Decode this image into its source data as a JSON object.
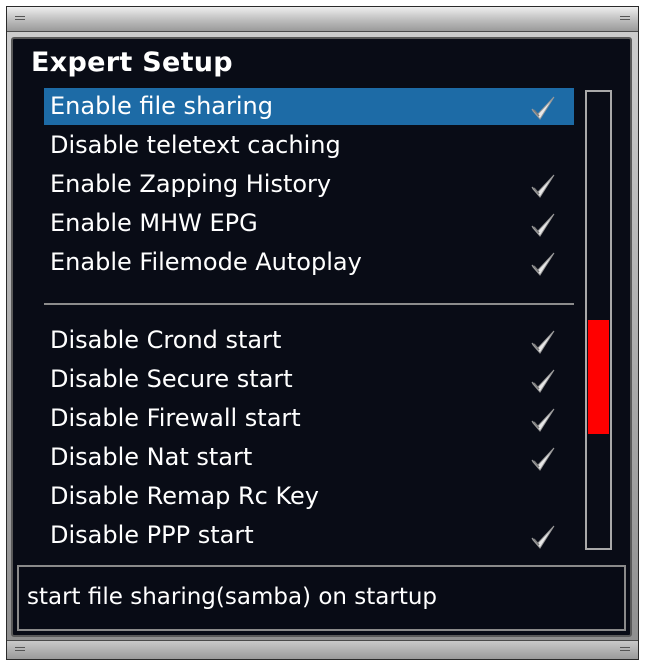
{
  "window": {
    "title": "Expert Setup"
  },
  "menu": {
    "items": [
      {
        "label": "Enable file sharing",
        "checked": true,
        "selected": true
      },
      {
        "label": "Disable teletext caching",
        "checked": false,
        "selected": false
      },
      {
        "label": "Enable Zapping History",
        "checked": true,
        "selected": false
      },
      {
        "label": "Enable MHW EPG",
        "checked": true,
        "selected": false
      },
      {
        "label": "Enable Filemode Autoplay",
        "checked": true,
        "selected": false
      },
      {
        "label": "Disable Crond start",
        "checked": true,
        "selected": false
      },
      {
        "label": "Disable Secure start",
        "checked": true,
        "selected": false
      },
      {
        "label": "Disable Firewall start",
        "checked": true,
        "selected": false
      },
      {
        "label": "Disable Nat start",
        "checked": true,
        "selected": false
      },
      {
        "label": "Disable Remap Rc Key",
        "checked": false,
        "selected": false
      },
      {
        "label": "Disable PPP start",
        "checked": true,
        "selected": false
      }
    ]
  },
  "scrollbar": {
    "thumb_start_fraction": 0.5,
    "thumb_length_fraction": 0.25,
    "thumb_color": "#ff0000"
  },
  "status": {
    "description": "start file sharing(samba) on startup"
  },
  "colors": {
    "background": "#090c16",
    "selection": "#1d6ba6",
    "text": "#ffffff"
  },
  "icons": {
    "check": "checkmark-icon",
    "grip": "window-grip-icon"
  }
}
